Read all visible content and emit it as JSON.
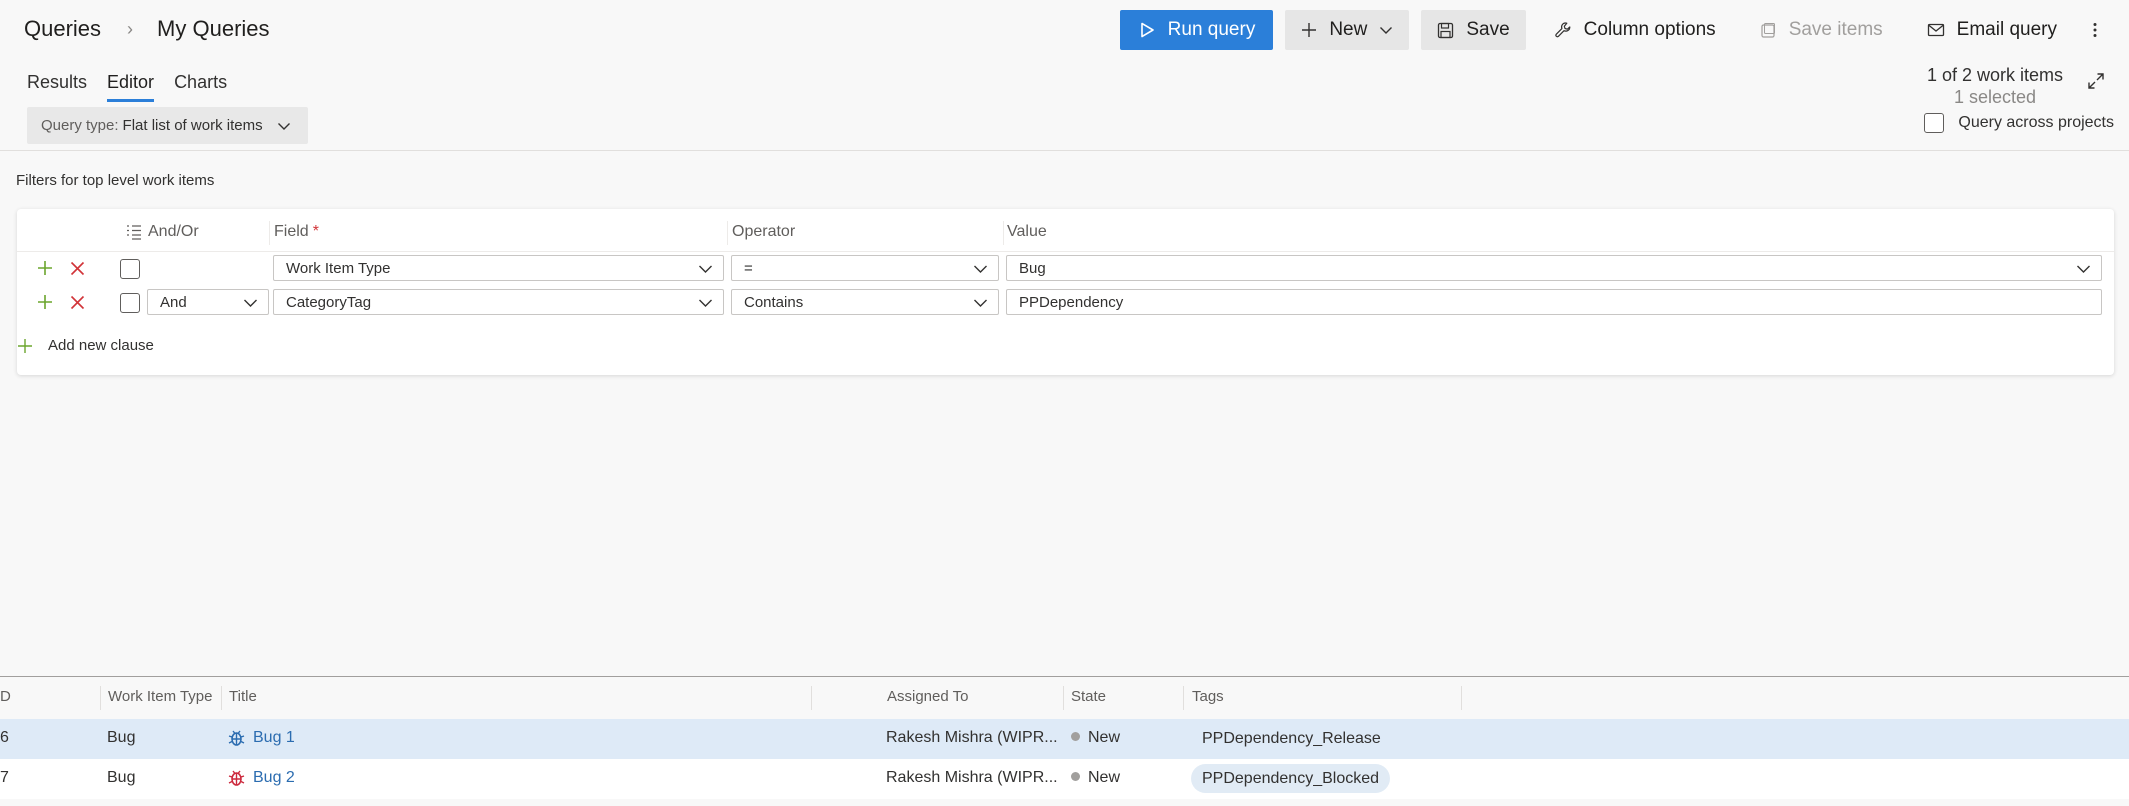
{
  "breadcrumb": {
    "root": "Queries",
    "separator": "›",
    "current": "My Queries"
  },
  "toolbar": {
    "run_query": "Run query",
    "new": "New",
    "save": "Save",
    "column_options": "Column options",
    "save_items": "Save items",
    "email_query": "Email query"
  },
  "tabs": [
    "Results",
    "Editor",
    "Charts"
  ],
  "active_tab": "Editor",
  "query_type": {
    "label": "Query type:",
    "value": "Flat list of work items"
  },
  "summary": {
    "count": "1 of 2 work items",
    "selected": "1 selected"
  },
  "query_across_projects": "Query across projects",
  "filters": {
    "title": "Filters for top level work items",
    "columns": {
      "andor": "And/Or",
      "field": "Field",
      "required_mark": "*",
      "operator": "Operator",
      "value": "Value"
    },
    "rows": [
      {
        "andor": "",
        "field": "Work Item Type",
        "operator": "=",
        "value": "Bug"
      },
      {
        "andor": "And",
        "field": "CategoryTag",
        "operator": "Contains",
        "value": "PPDependency"
      }
    ],
    "add_clause": "Add new clause"
  },
  "results": {
    "columns": {
      "id": "D",
      "type": "Work Item Type",
      "title": "Title",
      "assigned": "Assigned To",
      "state": "State",
      "tags": "Tags"
    },
    "rows": [
      {
        "id": "6",
        "type": "Bug",
        "title": "Bug 1",
        "assigned": "Rakesh Mishra (WIPR...",
        "state": "New",
        "tag": "PPDependency_Release",
        "icon_color": "#2b6cb0"
      },
      {
        "id": "7",
        "type": "Bug",
        "title": "Bug 2",
        "assigned": "Rakesh Mishra (WIPR...",
        "state": "New",
        "tag": "PPDependency_Blocked",
        "icon_color": "#cc293d"
      }
    ]
  },
  "colors": {
    "accent": "#2b7fd9",
    "add": "#6ba52d",
    "remove": "#d13438"
  }
}
